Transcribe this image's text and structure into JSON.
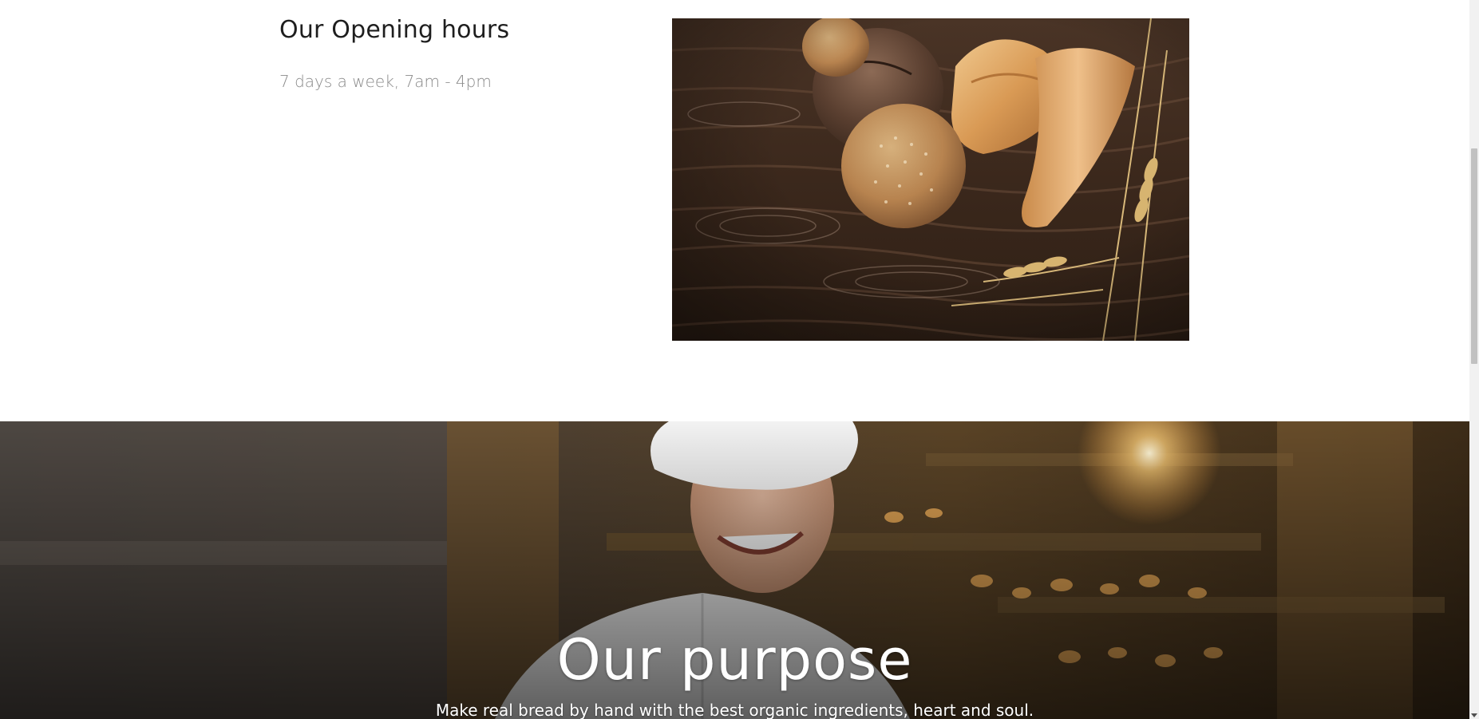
{
  "opening_hours": {
    "title": "Our Opening hours",
    "schedule": "7 days a week, 7am - 4pm"
  },
  "purpose": {
    "title": "Our purpose",
    "subtitle": "Make real bread by hand with the best organic ingredients, heart and soul."
  },
  "images": {
    "bread": "bread-loaves-on-wooden-table",
    "hero": "smiling-baker-in-white-chef-hat"
  },
  "colors": {
    "heading_text": "#1e1e1e",
    "muted_text": "#8a8a8a",
    "hero_text": "#ffffff"
  }
}
